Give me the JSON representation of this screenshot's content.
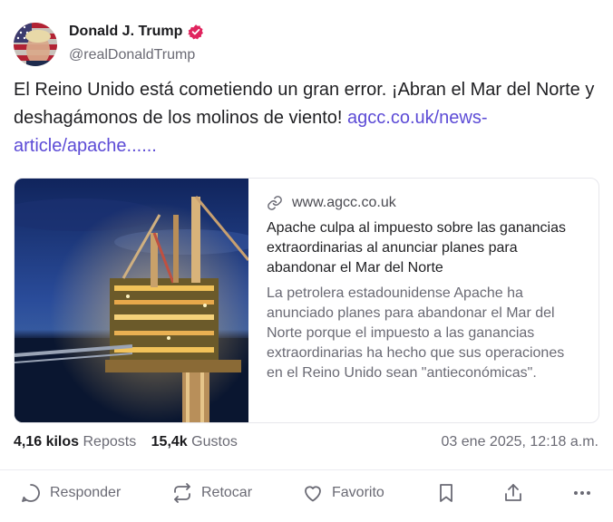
{
  "author": {
    "name": "Donald J. Trump",
    "handle": "@realDonaldTrump"
  },
  "post": {
    "text": "El Reino Unido está cometiendo un gran error. ¡Abran el Mar del Norte y deshagámonos de los molinos de viento! ",
    "link_text": "agcc.co.uk/news-article/apache......"
  },
  "link_card": {
    "domain": "www.agcc.co.uk",
    "title": "Apache culpa al impuesto sobre las ganancias extraordinarias al anunciar planes para abandonar el Mar del Norte",
    "description": "La petrolera estadounidense Apache ha anunciado planes para abandonar el Mar del Norte porque el impuesto a las ganancias extraordinarias ha hecho que sus operaciones en el Reino Unido sean \"antieconómicas\"."
  },
  "stats": {
    "reposts_count": "4,16 kilos",
    "reposts_label": "Reposts",
    "likes_count": "15,4k",
    "likes_label": "Gustos",
    "timestamp": "03 ene 2025, 12:18 a.m."
  },
  "actions": {
    "reply": "Responder",
    "retruth": "Retocar",
    "favorite": "Favorito"
  },
  "colors": {
    "verified": "#e0245e",
    "link": "#5c4bd6",
    "muted": "#6a6a74"
  },
  "icons": [
    "verified-badge-icon",
    "link-icon",
    "reply-icon",
    "retruth-icon",
    "heart-icon",
    "bookmark-icon",
    "share-icon",
    "more-icon"
  ]
}
